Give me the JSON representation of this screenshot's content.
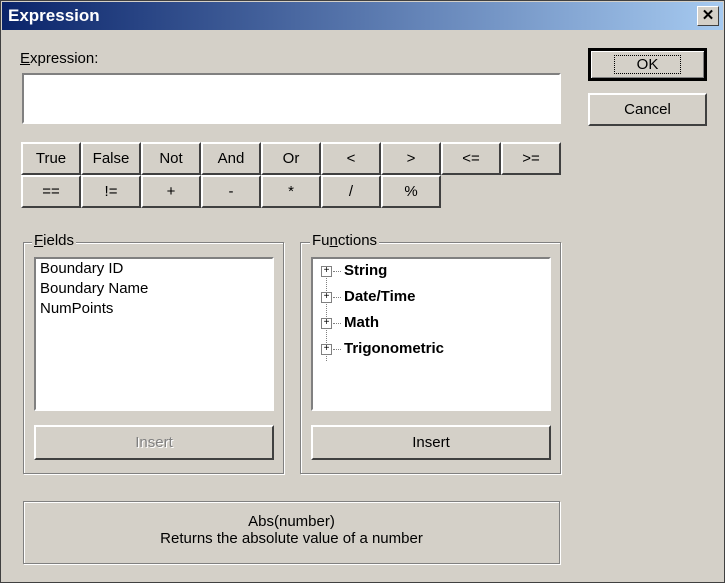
{
  "window": {
    "title": "Expression",
    "close_glyph": "✕"
  },
  "expression": {
    "label_accel": "E",
    "label_rest": "xpression:",
    "value": ""
  },
  "buttons": {
    "ok": "OK",
    "cancel": "Cancel"
  },
  "operators_row1": [
    "True",
    "False",
    "Not",
    "And",
    "Or",
    "<",
    ">",
    "<=",
    ">="
  ],
  "operators_row2": [
    "==",
    "!=",
    "+",
    "-",
    "*",
    "/",
    "%"
  ],
  "fields": {
    "label_accel": "F",
    "label_rest": "ields",
    "items": [
      "Boundary ID",
      "Boundary Name",
      "NumPoints"
    ],
    "insert_label": "Insert"
  },
  "functions": {
    "label_pre": "Fu",
    "label_accel": "n",
    "label_rest": "ctions",
    "items": [
      "String",
      "Date/Time",
      "Math",
      "Trigonometric"
    ],
    "expander_glyph": "+",
    "insert_label": "Insert"
  },
  "description": {
    "line1": "Abs(number)",
    "line2": "Returns the absolute value of a number"
  }
}
